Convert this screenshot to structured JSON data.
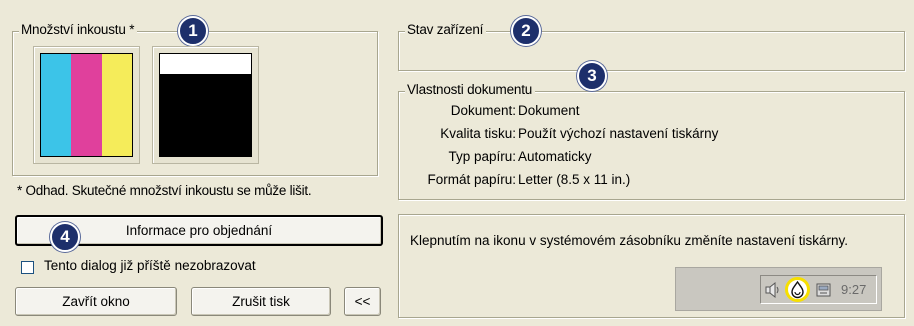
{
  "ink": {
    "title": "Množství inkoustu *",
    "badge": "1",
    "note": "* Odhad.  Skutečné množství inkoustu se může lišit.",
    "color_cartridge": {
      "stripes": [
        "#3cc4e8",
        "#e0409c",
        "#f5ec5a"
      ],
      "level": 1.0
    },
    "black_cartridge": {
      "color": "#000000",
      "level": 0.8
    }
  },
  "device_status": {
    "title": "Stav zařízení",
    "badge": "2"
  },
  "document_properties": {
    "title": "Vlastnosti dokumentu",
    "badge": "3",
    "rows": [
      {
        "label": "Dokument:",
        "value": "Dokument"
      },
      {
        "label": "Kvalita tisku:",
        "value": "Použít výchozí nastavení tiskárny"
      },
      {
        "label": "Typ papíru:",
        "value": "Automaticky"
      },
      {
        "label": "Formát papíru:",
        "value": "Letter (8.5 x 11 in.)"
      }
    ]
  },
  "order_info": {
    "button_label": "Informace pro objednání",
    "badge": "4"
  },
  "dont_show": {
    "label": "Tento dialog již příště nezobrazovat",
    "checked": false
  },
  "buttons": {
    "close": "Zavřít okno",
    "cancel_print": "Zrušit tisk",
    "collapse": "<<"
  },
  "hint": {
    "text": "Klepnutím na ikonu v systémovém zásobníku změníte nastavení tiskárny."
  },
  "tray": {
    "clock": "9:27",
    "icons": [
      "speaker-icon",
      "printer-ink-icon",
      "tray-app-icon"
    ]
  }
}
